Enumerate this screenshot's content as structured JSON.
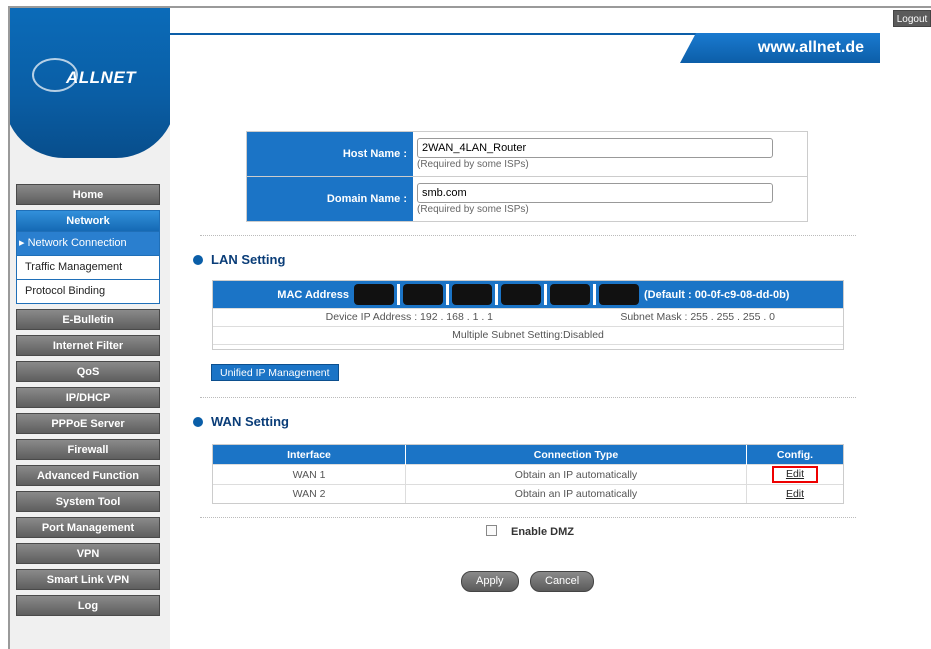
{
  "header": {
    "logout_label": "Logout",
    "brand_logo_text": "ALLNET",
    "site_url": "www.allnet.de"
  },
  "sidebar": {
    "items": [
      {
        "label": "Home"
      },
      {
        "label": "Network",
        "expanded": true,
        "children": [
          {
            "label": "Network Connection",
            "active": true
          },
          {
            "label": "Traffic Management"
          },
          {
            "label": "Protocol Binding"
          }
        ]
      },
      {
        "label": "E-Bulletin"
      },
      {
        "label": "Internet Filter"
      },
      {
        "label": "QoS"
      },
      {
        "label": "IP/DHCP"
      },
      {
        "label": "PPPoE Server"
      },
      {
        "label": "Firewall"
      },
      {
        "label": "Advanced Function"
      },
      {
        "label": "System Tool"
      },
      {
        "label": "Port Management"
      },
      {
        "label": "VPN"
      },
      {
        "label": "Smart Link VPN"
      },
      {
        "label": "Log"
      }
    ]
  },
  "host": {
    "host_name_label": "Host Name :",
    "host_name_value": "2WAN_4LAN_Router",
    "host_name_hint": "(Required by some ISPs)",
    "domain_name_label": "Domain Name :",
    "domain_name_value": "smb.com",
    "domain_name_hint": "(Required by some ISPs)"
  },
  "lan": {
    "section_title": "LAN Setting",
    "mac_label": "MAC Address",
    "mac_default": "(Default : 00-0f-c9-08-dd-0b)",
    "device_ip": "Device IP Address : 192 . 168 . 1 . 1",
    "subnet_mask": "Subnet Mask : 255 . 255 . 255 . 0",
    "multiple_subnet": "Multiple Subnet Setting:Disabled",
    "unified_button": "Unified IP Management"
  },
  "wan": {
    "section_title": "WAN Setting",
    "columns": [
      "Interface",
      "Connection Type",
      "Config."
    ],
    "rows": [
      {
        "interface": "WAN 1",
        "type": "Obtain an IP automatically",
        "config": "Edit",
        "highlighted": true
      },
      {
        "interface": "WAN 2",
        "type": "Obtain an IP automatically",
        "config": "Edit",
        "highlighted": false
      }
    ]
  },
  "dmz": {
    "label": "Enable DMZ",
    "checked": false
  },
  "actions": {
    "apply": "Apply",
    "cancel": "Cancel"
  },
  "colors": {
    "accent_blue": "#1b74c6",
    "menu_gray": "#6e6e6e",
    "highlight_red": "#e00000"
  }
}
